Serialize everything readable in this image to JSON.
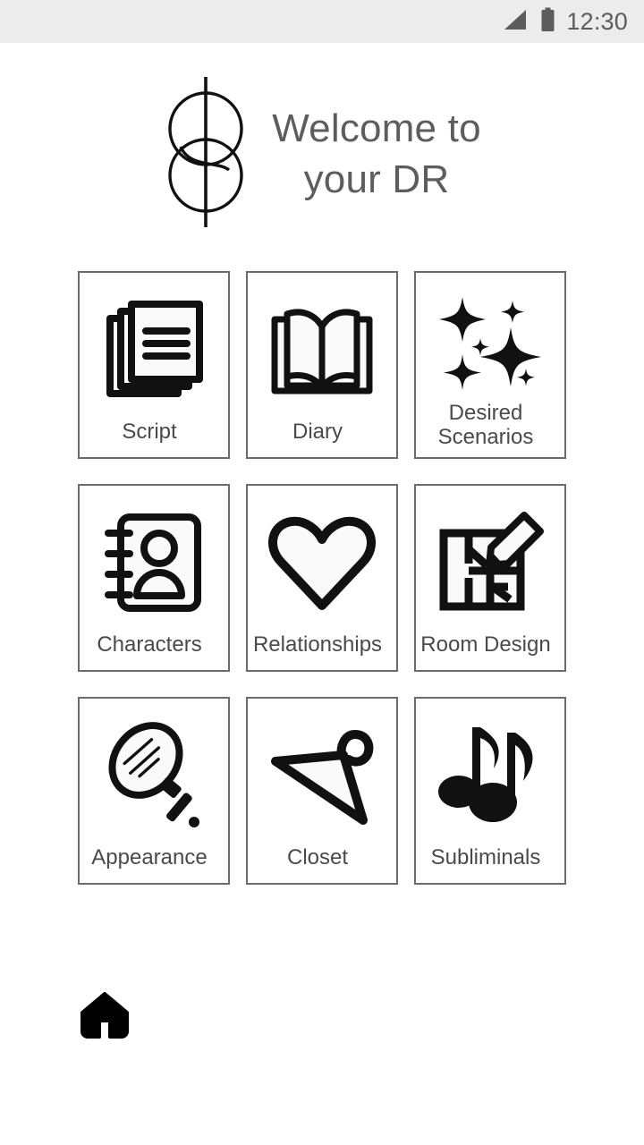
{
  "status_bar": {
    "time": "12:30",
    "signal_icon": "signal-triangle-icon",
    "battery_icon": "battery-full-icon",
    "background_color": "#ececec",
    "foreground_color": "#5c5c5c"
  },
  "header": {
    "logo_icon": "brand-two-circles-line-logo",
    "title": "Welcome to\nyour DR",
    "title_color": "#5d5d5d"
  },
  "grid": {
    "columns": 3,
    "rows": 3,
    "border_color": "#6b6b6b",
    "label_color": "#4a4a4a",
    "tiles": [
      {
        "label": "Script",
        "icon": "stacked-pages-icon",
        "lines": 1
      },
      {
        "label": "Diary",
        "icon": "open-book-icon",
        "lines": 1
      },
      {
        "label": "Desired\nScenarios",
        "icon": "sparkles-icon",
        "lines": 2
      },
      {
        "label": "Characters",
        "icon": "contact-book-icon",
        "lines": 1
      },
      {
        "label": "Relationships",
        "icon": "heart-outline-icon",
        "lines": 1
      },
      {
        "label": "Room Design",
        "icon": "floor-plan-pencil-icon",
        "lines": 1
      },
      {
        "label": "Appearance",
        "icon": "hand-mirror-icon",
        "lines": 1
      },
      {
        "label": "Closet",
        "icon": "clothes-hanger-icon",
        "lines": 1
      },
      {
        "label": "Subliminals",
        "icon": "music-notes-icon",
        "lines": 1
      }
    ]
  },
  "footer": {
    "home_icon": "home-icon",
    "home_color": "#000000"
  }
}
